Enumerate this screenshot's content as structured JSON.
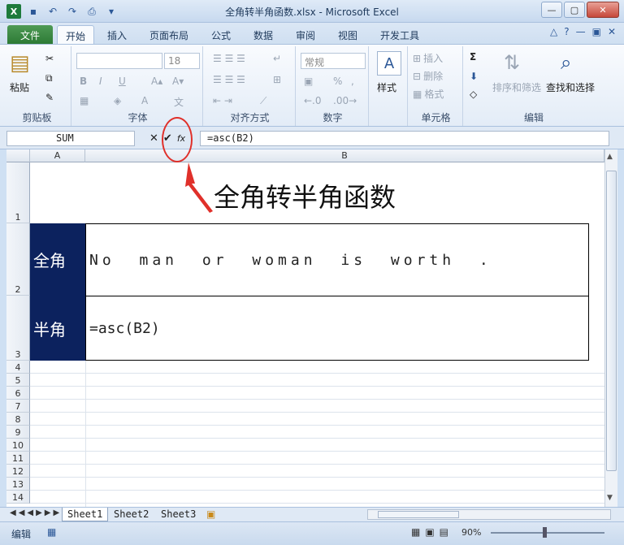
{
  "window": {
    "title": "全角转半角函数.xlsx - Microsoft Excel",
    "controls": [
      "—",
      "▢",
      "✕"
    ]
  },
  "qat": {
    "app_icon": "X"
  },
  "tabs": [
    "文件",
    "开始",
    "插入",
    "页面布局",
    "公式",
    "数据",
    "审阅",
    "视图",
    "开发工具"
  ],
  "ribbon": {
    "clipboard": {
      "paste": "粘贴",
      "label": "剪贴板"
    },
    "font": {
      "size": "18",
      "bold": "B",
      "italic": "I",
      "underline": "U",
      "label": "字体"
    },
    "alignment": {
      "label": "对齐方式"
    },
    "number": {
      "format": "常规",
      "percent": "%",
      "comma": ",",
      "label": "数字"
    },
    "styles": {
      "label": "样式"
    },
    "cells": {
      "insert": "插入",
      "delete": "删除",
      "format": "格式",
      "label": "单元格"
    },
    "editing": {
      "sort": "排序和筛选",
      "find": "查找和选择",
      "label": "编辑",
      "sigma": "Σ"
    }
  },
  "formula_bar": {
    "name_box": "SUM",
    "cancel": "✕",
    "enter": "✔",
    "fx": "fx",
    "formula": "=asc(B2)"
  },
  "columns": [
    "A",
    "B"
  ],
  "rows": [
    "1",
    "2",
    "3",
    "4",
    "5",
    "6",
    "7",
    "8",
    "9",
    "10",
    "11",
    "12",
    "13",
    "14"
  ],
  "cells": {
    "heading": "全角转半角函数",
    "a2": "全角",
    "b2": "No man or woman is worth .",
    "a3": "半角",
    "b3": "=asc(B2)"
  },
  "sheets": [
    "Sheet1",
    "Sheet2",
    "Sheet3"
  ],
  "status": {
    "mode": "编辑",
    "zoom": "90%"
  },
  "annotation": {
    "color": "#e0302a"
  }
}
